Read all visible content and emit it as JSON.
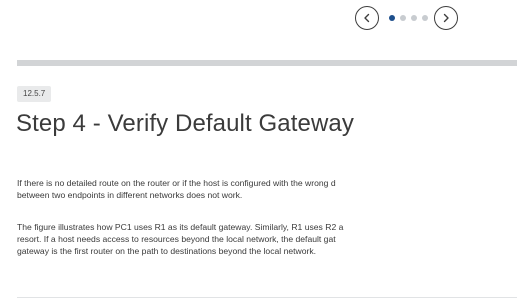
{
  "pager": {
    "prev_icon": "chevron-left-icon",
    "next_icon": "chevron-right-icon",
    "current_page": 1,
    "total_pages": 4,
    "active_color": "#1d4f8c",
    "inactive_color": "#c8ccd0"
  },
  "section": {
    "number": "12.5.7",
    "title": "Step 4 - Verify Default Gateway"
  },
  "paragraphs": [
    {
      "lines": [
        "If there is no detailed route on the router or if the host is configured with the wrong d",
        "between two endpoints in different networks does not work."
      ]
    },
    {
      "lines": [
        "The figure illustrates how PC1 uses R1 as its default gateway. Similarly, R1 uses R2 a",
        "resort. If a host needs access to resources beyond the local network, the default gat",
        "gateway is the first router on the path to destinations beyond the local network."
      ]
    }
  ]
}
